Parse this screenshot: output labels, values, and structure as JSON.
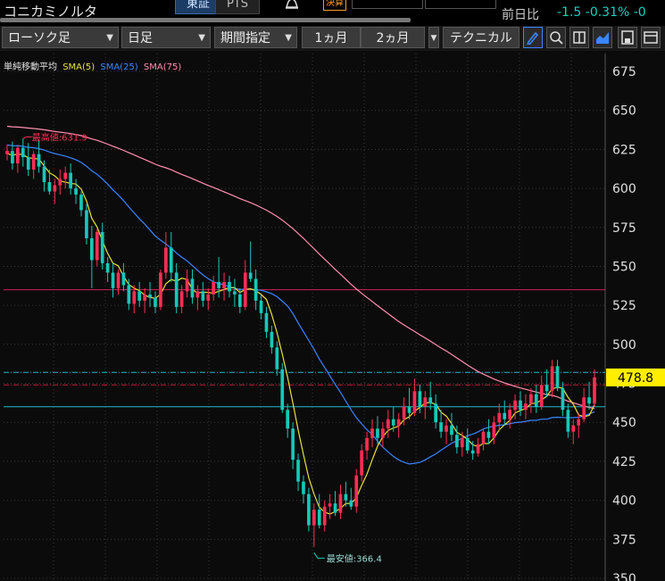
{
  "header": {
    "stock_name": "コニカミノルタ",
    "market_tabs": [
      "東証",
      "PTS"
    ],
    "badge": "決算",
    "prev_day_label": "前日比",
    "prev_day_value": "-1.5  -0.31%  -0"
  },
  "toolbar": {
    "chart_style": "ローソク足",
    "interval": "日足",
    "period": "期間指定",
    "range_1m": "1ヵ月",
    "range_2m": "2ヵ月",
    "technical": "テクニカル"
  },
  "colors": {
    "up": "#ff2d55",
    "down": "#16c8b8",
    "sma5": "#e8e23a",
    "sma25": "#3a86ff",
    "sma75": "#ff8fb0",
    "grid": "#3a3a3a",
    "price_box": "#ffee00"
  },
  "chart_data": {
    "type": "candlestick",
    "legend_title": "単純移動平均",
    "series_labels": [
      "SMA(5)",
      "SMA(25)",
      "SMA(75)"
    ],
    "y_ticks": [
      350,
      375,
      400,
      425,
      450,
      475,
      500,
      525,
      550,
      575,
      600,
      625,
      650,
      675
    ],
    "ylim": [
      350,
      685
    ],
    "current_price": 478.8,
    "current_price_label": "478.8",
    "high_label": "最高値:631.9",
    "high_value": 631.9,
    "low_label": "最安値:366.4",
    "low_value": 366.4,
    "hlines": [
      {
        "value": 535,
        "color": "#d1205a",
        "style": "solid"
      },
      {
        "value": 482,
        "color": "#23b8c9",
        "style": "dashdot"
      },
      {
        "value": 474,
        "color": "#c0203a",
        "style": "dashdot"
      },
      {
        "value": 460,
        "color": "#23b8c9",
        "style": "solid"
      }
    ],
    "candles": [
      [
        622,
        628,
        618,
        624
      ],
      [
        624,
        630,
        612,
        616
      ],
      [
        616,
        628,
        610,
        626
      ],
      [
        626,
        632,
        614,
        620
      ],
      [
        620,
        629,
        608,
        612
      ],
      [
        612,
        624,
        606,
        622
      ],
      [
        622,
        631,
        610,
        614
      ],
      [
        614,
        618,
        598,
        604
      ],
      [
        604,
        612,
        596,
        598
      ],
      [
        598,
        606,
        590,
        602
      ],
      [
        602,
        612,
        596,
        606
      ],
      [
        606,
        614,
        600,
        610
      ],
      [
        610,
        616,
        596,
        600
      ],
      [
        600,
        606,
        590,
        596
      ],
      [
        596,
        598,
        582,
        586
      ],
      [
        586,
        590,
        564,
        568
      ],
      [
        568,
        576,
        536,
        554
      ],
      [
        554,
        574,
        550,
        572
      ],
      [
        572,
        578,
        548,
        552
      ],
      [
        552,
        556,
        540,
        546
      ],
      [
        546,
        552,
        530,
        536
      ],
      [
        536,
        548,
        532,
        546
      ],
      [
        546,
        552,
        534,
        538
      ],
      [
        538,
        542,
        522,
        526
      ],
      [
        526,
        538,
        520,
        534
      ],
      [
        534,
        540,
        524,
        528
      ],
      [
        528,
        536,
        520,
        532
      ],
      [
        532,
        540,
        524,
        530
      ],
      [
        530,
        534,
        520,
        524
      ],
      [
        524,
        548,
        522,
        546
      ],
      [
        546,
        572,
        542,
        562
      ],
      [
        562,
        572,
        540,
        546
      ],
      [
        546,
        552,
        520,
        524
      ],
      [
        524,
        538,
        520,
        534
      ],
      [
        534,
        548,
        530,
        542
      ],
      [
        542,
        548,
        526,
        530
      ],
      [
        530,
        538,
        522,
        534
      ],
      [
        534,
        540,
        524,
        528
      ],
      [
        528,
        536,
        522,
        532
      ],
      [
        532,
        544,
        528,
        540
      ],
      [
        540,
        556,
        530,
        536
      ],
      [
        536,
        546,
        528,
        540
      ],
      [
        540,
        544,
        530,
        534
      ],
      [
        534,
        542,
        524,
        532
      ],
      [
        532,
        536,
        520,
        524
      ],
      [
        524,
        554,
        522,
        546
      ],
      [
        546,
        566,
        540,
        542
      ],
      [
        542,
        548,
        522,
        528
      ],
      [
        528,
        532,
        516,
        520
      ],
      [
        520,
        524,
        504,
        508
      ],
      [
        508,
        512,
        494,
        498
      ],
      [
        498,
        502,
        480,
        484
      ],
      [
        484,
        488,
        456,
        458
      ],
      [
        458,
        462,
        440,
        446
      ],
      [
        446,
        450,
        420,
        426
      ],
      [
        426,
        430,
        406,
        412
      ],
      [
        412,
        416,
        398,
        404
      ],
      [
        404,
        408,
        380,
        384
      ],
      [
        384,
        398,
        370,
        394
      ],
      [
        394,
        404,
        382,
        384
      ],
      [
        384,
        400,
        380,
        396
      ],
      [
        396,
        404,
        388,
        398
      ],
      [
        398,
        406,
        390,
        392
      ],
      [
        392,
        410,
        388,
        404
      ],
      [
        404,
        412,
        396,
        400
      ],
      [
        400,
        408,
        394,
        396
      ],
      [
        396,
        420,
        392,
        416
      ],
      [
        416,
        436,
        412,
        432
      ],
      [
        432,
        444,
        426,
        440
      ],
      [
        440,
        452,
        434,
        446
      ],
      [
        446,
        454,
        436,
        440
      ],
      [
        440,
        450,
        434,
        446
      ],
      [
        446,
        458,
        440,
        452
      ],
      [
        452,
        460,
        444,
        448
      ],
      [
        448,
        456,
        440,
        452
      ],
      [
        452,
        466,
        448,
        460
      ],
      [
        460,
        472,
        452,
        456
      ],
      [
        456,
        478,
        454,
        470
      ],
      [
        470,
        474,
        456,
        460
      ],
      [
        460,
        470,
        452,
        466
      ],
      [
        466,
        476,
        458,
        462
      ],
      [
        462,
        468,
        446,
        450
      ],
      [
        450,
        458,
        440,
        444
      ],
      [
        444,
        452,
        436,
        448
      ],
      [
        448,
        456,
        438,
        442
      ],
      [
        442,
        448,
        430,
        434
      ],
      [
        434,
        444,
        428,
        440
      ],
      [
        440,
        446,
        430,
        432
      ],
      [
        432,
        438,
        426,
        430
      ],
      [
        430,
        440,
        428,
        436
      ],
      [
        436,
        446,
        432,
        444
      ],
      [
        444,
        452,
        436,
        440
      ],
      [
        440,
        454,
        436,
        450
      ],
      [
        450,
        462,
        444,
        456
      ],
      [
        456,
        464,
        448,
        452
      ],
      [
        452,
        462,
        446,
        458
      ],
      [
        458,
        468,
        452,
        464
      ],
      [
        464,
        470,
        454,
        458
      ],
      [
        458,
        468,
        452,
        462
      ],
      [
        462,
        472,
        456,
        468
      ],
      [
        468,
        474,
        456,
        460
      ],
      [
        460,
        480,
        458,
        474
      ],
      [
        474,
        484,
        466,
        470
      ],
      [
        470,
        490,
        466,
        486
      ],
      [
        486,
        490,
        470,
        472
      ],
      [
        472,
        476,
        454,
        458
      ],
      [
        458,
        462,
        440,
        444
      ],
      [
        444,
        452,
        436,
        448
      ],
      [
        448,
        456,
        440,
        452
      ],
      [
        452,
        472,
        450,
        466
      ],
      [
        466,
        476,
        458,
        462
      ],
      [
        462,
        484,
        460,
        478.8
      ]
    ]
  }
}
